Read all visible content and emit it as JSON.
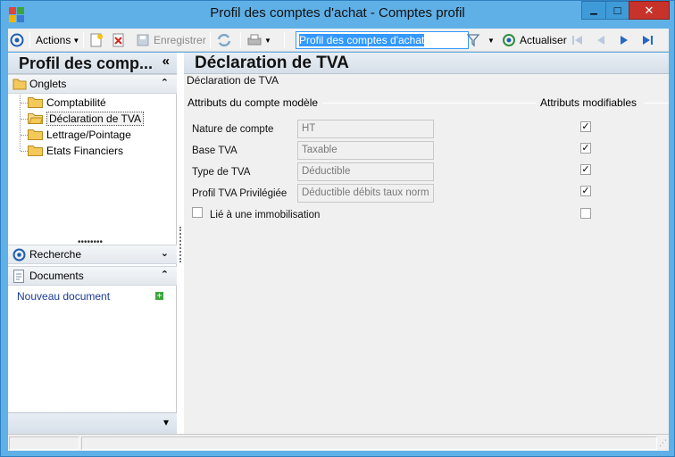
{
  "window": {
    "title": "Profil des comptes d'achat -  Comptes profil",
    "minimize_glyph": "▁",
    "maximize_glyph": "□",
    "close_glyph": "✕"
  },
  "toolbar": {
    "actions_label": "Actions",
    "save_label": "Enregistrer",
    "search_value": "Profil des comptes d'achat",
    "refresh_label": "Actualiser"
  },
  "left_panel": {
    "title": "Profil des comp...",
    "collapse_glyph": "«",
    "onglets": {
      "label": "Onglets",
      "chevron": "⌃",
      "items": [
        {
          "label": "Comptabilité"
        },
        {
          "label": "Déclaration de TVA",
          "selected": true
        },
        {
          "label": "Lettrage/Pointage"
        },
        {
          "label": "Etats Financiers"
        }
      ]
    },
    "grip": "••••••••",
    "recherche": {
      "label": "Recherche",
      "chevron": "⌄"
    },
    "documents": {
      "label": "Documents",
      "chevron": "⌃",
      "new_link": "Nouveau document"
    },
    "bottom_chevron": "▾"
  },
  "main": {
    "title": "Déclaration de TVA",
    "subtitle": "Déclaration de TVA",
    "group_left": "Attributs du compte modèle",
    "group_right": "Attributs modifiables",
    "fields": [
      {
        "label": "Nature de compte",
        "value": "HT",
        "modifiable": true
      },
      {
        "label": "Base TVA",
        "value": "Taxable",
        "modifiable": true
      },
      {
        "label": "Type de TVA",
        "value": "Déductible",
        "modifiable": true
      },
      {
        "label": "Profil TVA Privilégiée",
        "value": "Déductible débits taux norm",
        "modifiable": true
      }
    ],
    "immobilisation": {
      "label": "Lié à une immobilisation",
      "checked": false,
      "modifiable": false
    }
  },
  "colors": {
    "frame": "#5fb0e6",
    "close": "#c7322b",
    "selection": "#3399ff",
    "link": "#1a3a9a",
    "add_green": "#3ba63b"
  }
}
